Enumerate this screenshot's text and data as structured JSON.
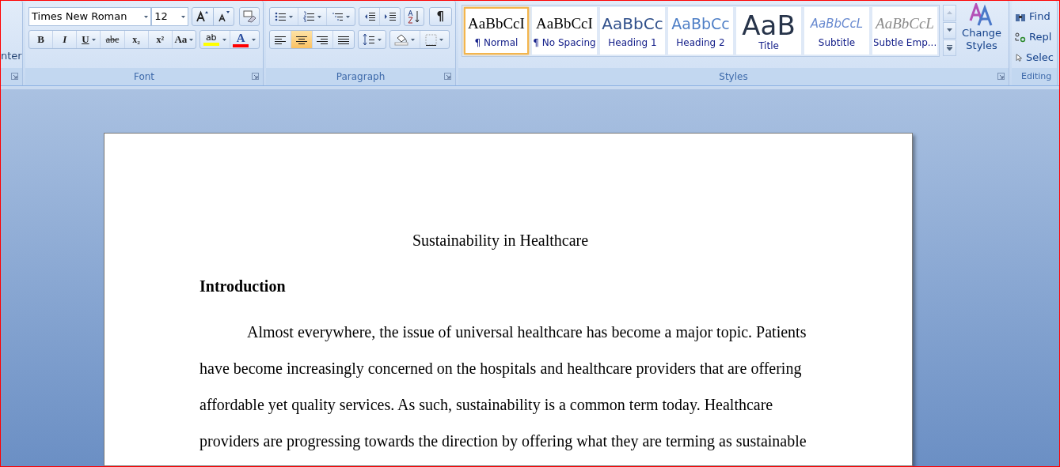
{
  "ribbon": {
    "clipboard_group": {
      "label_fragment": "nter"
    },
    "font_group": {
      "label": "Font",
      "font_name": "Times New Roman",
      "font_size": "12",
      "format_buttons": [
        {
          "kind": "bold",
          "glyph": "B",
          "has_menu": false
        },
        {
          "kind": "italic",
          "glyph": "I",
          "has_menu": false
        },
        {
          "kind": "underline",
          "glyph": "U",
          "has_menu": true
        },
        {
          "kind": "strike",
          "glyph": "abc",
          "has_menu": false
        },
        {
          "kind": "subscript",
          "glyph": "x₂",
          "has_menu": false
        },
        {
          "kind": "superscript",
          "glyph": "x²",
          "has_menu": false
        },
        {
          "kind": "case",
          "glyph": "Aa",
          "has_menu": true
        }
      ],
      "color_buttons": [
        {
          "kind": "highlight",
          "glyph": "ab",
          "color": "#ffff00"
        },
        {
          "kind": "font_color",
          "glyph": "A",
          "color": "#ff0000"
        }
      ]
    },
    "paragraph_group": {
      "label": "Paragraph",
      "show_marks_glyph": "¶",
      "alignments": [
        {
          "kind": "left",
          "selected": false
        },
        {
          "kind": "center",
          "selected": true
        },
        {
          "kind": "right",
          "selected": false
        },
        {
          "kind": "justify",
          "selected": false
        }
      ]
    },
    "styles_group": {
      "label": "Styles",
      "change_styles": "Change Styles",
      "styles": [
        {
          "kind": "normal",
          "preview": "AaBbCcI",
          "label": "¶ Normal",
          "selected": true
        },
        {
          "kind": "nospacing",
          "preview": "AaBbCcI",
          "label": "¶ No Spacing",
          "selected": false
        },
        {
          "kind": "heading1",
          "preview": "AaBbCc",
          "label": "Heading 1",
          "selected": false
        },
        {
          "kind": "heading2",
          "preview": "AaBbCc",
          "label": "Heading 2",
          "selected": false
        },
        {
          "kind": "title",
          "preview": "AaB",
          "label": "Title",
          "selected": false
        },
        {
          "kind": "subtitle",
          "preview": "AaBbCcL",
          "label": "Subtitle",
          "selected": false
        },
        {
          "kind": "subtleemph",
          "preview": "AaBbCcL",
          "label": "Subtle Emp...",
          "selected": false
        }
      ]
    },
    "editing_group": {
      "label": "Editing",
      "items": [
        {
          "kind": "find",
          "label": "Find"
        },
        {
          "kind": "replace",
          "label": "Repl"
        },
        {
          "kind": "select",
          "label": "Selec"
        }
      ]
    }
  },
  "document": {
    "title": "Sustainability in Healthcare",
    "heading": "Introduction",
    "paragraph": "Almost everywhere, the issue of universal healthcare has become a major topic. Patients have become increasingly concerned on the hospitals and healthcare providers that are offering affordable yet quality services. As such, sustainability is a common term today. Healthcare providers are progressing towards the direction by offering what they are terming as sustainable"
  }
}
